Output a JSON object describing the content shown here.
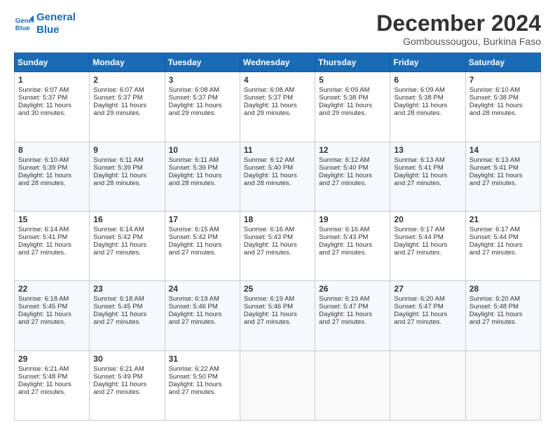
{
  "logo": {
    "line1": "General",
    "line2": "Blue"
  },
  "title": "December 2024",
  "subtitle": "Gomboussougou, Burkina Faso",
  "days_header": [
    "Sunday",
    "Monday",
    "Tuesday",
    "Wednesday",
    "Thursday",
    "Friday",
    "Saturday"
  ],
  "weeks": [
    [
      {
        "day": 1,
        "lines": [
          "Sunrise: 6:07 AM",
          "Sunset: 5:37 PM",
          "Daylight: 11 hours",
          "and 30 minutes."
        ]
      },
      {
        "day": 2,
        "lines": [
          "Sunrise: 6:07 AM",
          "Sunset: 5:37 PM",
          "Daylight: 11 hours",
          "and 29 minutes."
        ]
      },
      {
        "day": 3,
        "lines": [
          "Sunrise: 6:08 AM",
          "Sunset: 5:37 PM",
          "Daylight: 11 hours",
          "and 29 minutes."
        ]
      },
      {
        "day": 4,
        "lines": [
          "Sunrise: 6:08 AM",
          "Sunset: 5:37 PM",
          "Daylight: 11 hours",
          "and 29 minutes."
        ]
      },
      {
        "day": 5,
        "lines": [
          "Sunrise: 6:09 AM",
          "Sunset: 5:38 PM",
          "Daylight: 11 hours",
          "and 29 minutes."
        ]
      },
      {
        "day": 6,
        "lines": [
          "Sunrise: 6:09 AM",
          "Sunset: 5:38 PM",
          "Daylight: 11 hours",
          "and 28 minutes."
        ]
      },
      {
        "day": 7,
        "lines": [
          "Sunrise: 6:10 AM",
          "Sunset: 5:38 PM",
          "Daylight: 11 hours",
          "and 28 minutes."
        ]
      }
    ],
    [
      {
        "day": 8,
        "lines": [
          "Sunrise: 6:10 AM",
          "Sunset: 5:39 PM",
          "Daylight: 11 hours",
          "and 28 minutes."
        ]
      },
      {
        "day": 9,
        "lines": [
          "Sunrise: 6:11 AM",
          "Sunset: 5:39 PM",
          "Daylight: 11 hours",
          "and 28 minutes."
        ]
      },
      {
        "day": 10,
        "lines": [
          "Sunrise: 6:11 AM",
          "Sunset: 5:39 PM",
          "Daylight: 11 hours",
          "and 28 minutes."
        ]
      },
      {
        "day": 11,
        "lines": [
          "Sunrise: 6:12 AM",
          "Sunset: 5:40 PM",
          "Daylight: 11 hours",
          "and 28 minutes."
        ]
      },
      {
        "day": 12,
        "lines": [
          "Sunrise: 6:12 AM",
          "Sunset: 5:40 PM",
          "Daylight: 11 hours",
          "and 27 minutes."
        ]
      },
      {
        "day": 13,
        "lines": [
          "Sunrise: 6:13 AM",
          "Sunset: 5:41 PM",
          "Daylight: 11 hours",
          "and 27 minutes."
        ]
      },
      {
        "day": 14,
        "lines": [
          "Sunrise: 6:13 AM",
          "Sunset: 5:41 PM",
          "Daylight: 11 hours",
          "and 27 minutes."
        ]
      }
    ],
    [
      {
        "day": 15,
        "lines": [
          "Sunrise: 6:14 AM",
          "Sunset: 5:41 PM",
          "Daylight: 11 hours",
          "and 27 minutes."
        ]
      },
      {
        "day": 16,
        "lines": [
          "Sunrise: 6:14 AM",
          "Sunset: 5:42 PM",
          "Daylight: 11 hours",
          "and 27 minutes."
        ]
      },
      {
        "day": 17,
        "lines": [
          "Sunrise: 6:15 AM",
          "Sunset: 5:42 PM",
          "Daylight: 11 hours",
          "and 27 minutes."
        ]
      },
      {
        "day": 18,
        "lines": [
          "Sunrise: 6:16 AM",
          "Sunset: 5:43 PM",
          "Daylight: 11 hours",
          "and 27 minutes."
        ]
      },
      {
        "day": 19,
        "lines": [
          "Sunrise: 6:16 AM",
          "Sunset: 5:43 PM",
          "Daylight: 11 hours",
          "and 27 minutes."
        ]
      },
      {
        "day": 20,
        "lines": [
          "Sunrise: 6:17 AM",
          "Sunset: 5:44 PM",
          "Daylight: 11 hours",
          "and 27 minutes."
        ]
      },
      {
        "day": 21,
        "lines": [
          "Sunrise: 6:17 AM",
          "Sunset: 5:44 PM",
          "Daylight: 11 hours",
          "and 27 minutes."
        ]
      }
    ],
    [
      {
        "day": 22,
        "lines": [
          "Sunrise: 6:18 AM",
          "Sunset: 5:45 PM",
          "Daylight: 11 hours",
          "and 27 minutes."
        ]
      },
      {
        "day": 23,
        "lines": [
          "Sunrise: 6:18 AM",
          "Sunset: 5:45 PM",
          "Daylight: 11 hours",
          "and 27 minutes."
        ]
      },
      {
        "day": 24,
        "lines": [
          "Sunrise: 6:19 AM",
          "Sunset: 5:46 PM",
          "Daylight: 11 hours",
          "and 27 minutes."
        ]
      },
      {
        "day": 25,
        "lines": [
          "Sunrise: 6:19 AM",
          "Sunset: 5:46 PM",
          "Daylight: 11 hours",
          "and 27 minutes."
        ]
      },
      {
        "day": 26,
        "lines": [
          "Sunrise: 6:19 AM",
          "Sunset: 5:47 PM",
          "Daylight: 11 hours",
          "and 27 minutes."
        ]
      },
      {
        "day": 27,
        "lines": [
          "Sunrise: 6:20 AM",
          "Sunset: 5:47 PM",
          "Daylight: 11 hours",
          "and 27 minutes."
        ]
      },
      {
        "day": 28,
        "lines": [
          "Sunrise: 6:20 AM",
          "Sunset: 5:48 PM",
          "Daylight: 11 hours",
          "and 27 minutes."
        ]
      }
    ],
    [
      {
        "day": 29,
        "lines": [
          "Sunrise: 6:21 AM",
          "Sunset: 5:48 PM",
          "Daylight: 11 hours",
          "and 27 minutes."
        ]
      },
      {
        "day": 30,
        "lines": [
          "Sunrise: 6:21 AM",
          "Sunset: 5:49 PM",
          "Daylight: 11 hours",
          "and 27 minutes."
        ]
      },
      {
        "day": 31,
        "lines": [
          "Sunrise: 6:22 AM",
          "Sunset: 5:50 PM",
          "Daylight: 11 hours",
          "and 27 minutes."
        ]
      },
      null,
      null,
      null,
      null
    ]
  ]
}
